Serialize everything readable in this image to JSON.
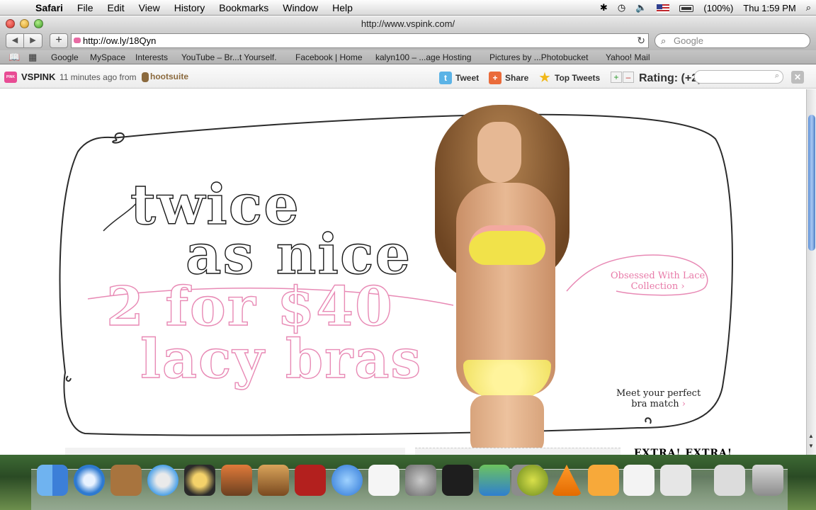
{
  "menubar": {
    "app": "Safari",
    "menus": [
      "File",
      "Edit",
      "View",
      "History",
      "Bookmarks",
      "Window",
      "Help"
    ],
    "battery": "(100%)",
    "clock": "Thu 1:59 PM"
  },
  "window": {
    "title": "http://www.vspink.com/"
  },
  "toolbar": {
    "back": "◀",
    "forward": "▶",
    "add": "+",
    "url": "http://ow.ly/18Qyn",
    "reload": "↻",
    "search_placeholder": "Google"
  },
  "bookmarks": [
    "Google",
    "MySpace",
    "Interests",
    "YouTube – Br...t Yourself.",
    "Facebook | Home",
    "kalyn100 – ...age Hosting",
    "Pictures by ...Photobucket",
    "Yahoo! Mail"
  ],
  "hootbar": {
    "badge": "PINK",
    "name": "VSPINK",
    "time": "11 minutes ago from",
    "source": "hootsuite",
    "tweet": "Tweet",
    "share": "Share",
    "top_tweets": "Top Tweets",
    "plus": "+",
    "minus": "–",
    "rating": "Rating: (+2)",
    "close": "✕"
  },
  "banner": {
    "line1": "twice",
    "line2": "as nice",
    "line3": "2 for $40",
    "line4": "lacy bras",
    "lace_cta_1": "Obsessed With Lace",
    "lace_cta_2": "Collection",
    "match_cta_1": "Meet your perfect",
    "match_cta_2": "bra match",
    "extra": "EXTRA! EXTRA!"
  },
  "colors": {
    "accent_pink": "#e88ab5",
    "outline_black": "#1a1a1a",
    "brand_pink": "#e84c94"
  },
  "dock": {
    "icons": [
      "finder-icon",
      "safari-icon",
      "address-book-icon",
      "itunes-icon",
      "imovie-icon",
      "iphoto-icon",
      "garageband-icon",
      "photo-booth-icon",
      "ichat-icon",
      "textedit-icon",
      "system-preferences-icon",
      "app-icon",
      "app-icon",
      "app-icon",
      "app-icon",
      "vlc-icon",
      "app-icon",
      "app-icon",
      "app-icon",
      "app-icon",
      "trash-icon"
    ]
  }
}
